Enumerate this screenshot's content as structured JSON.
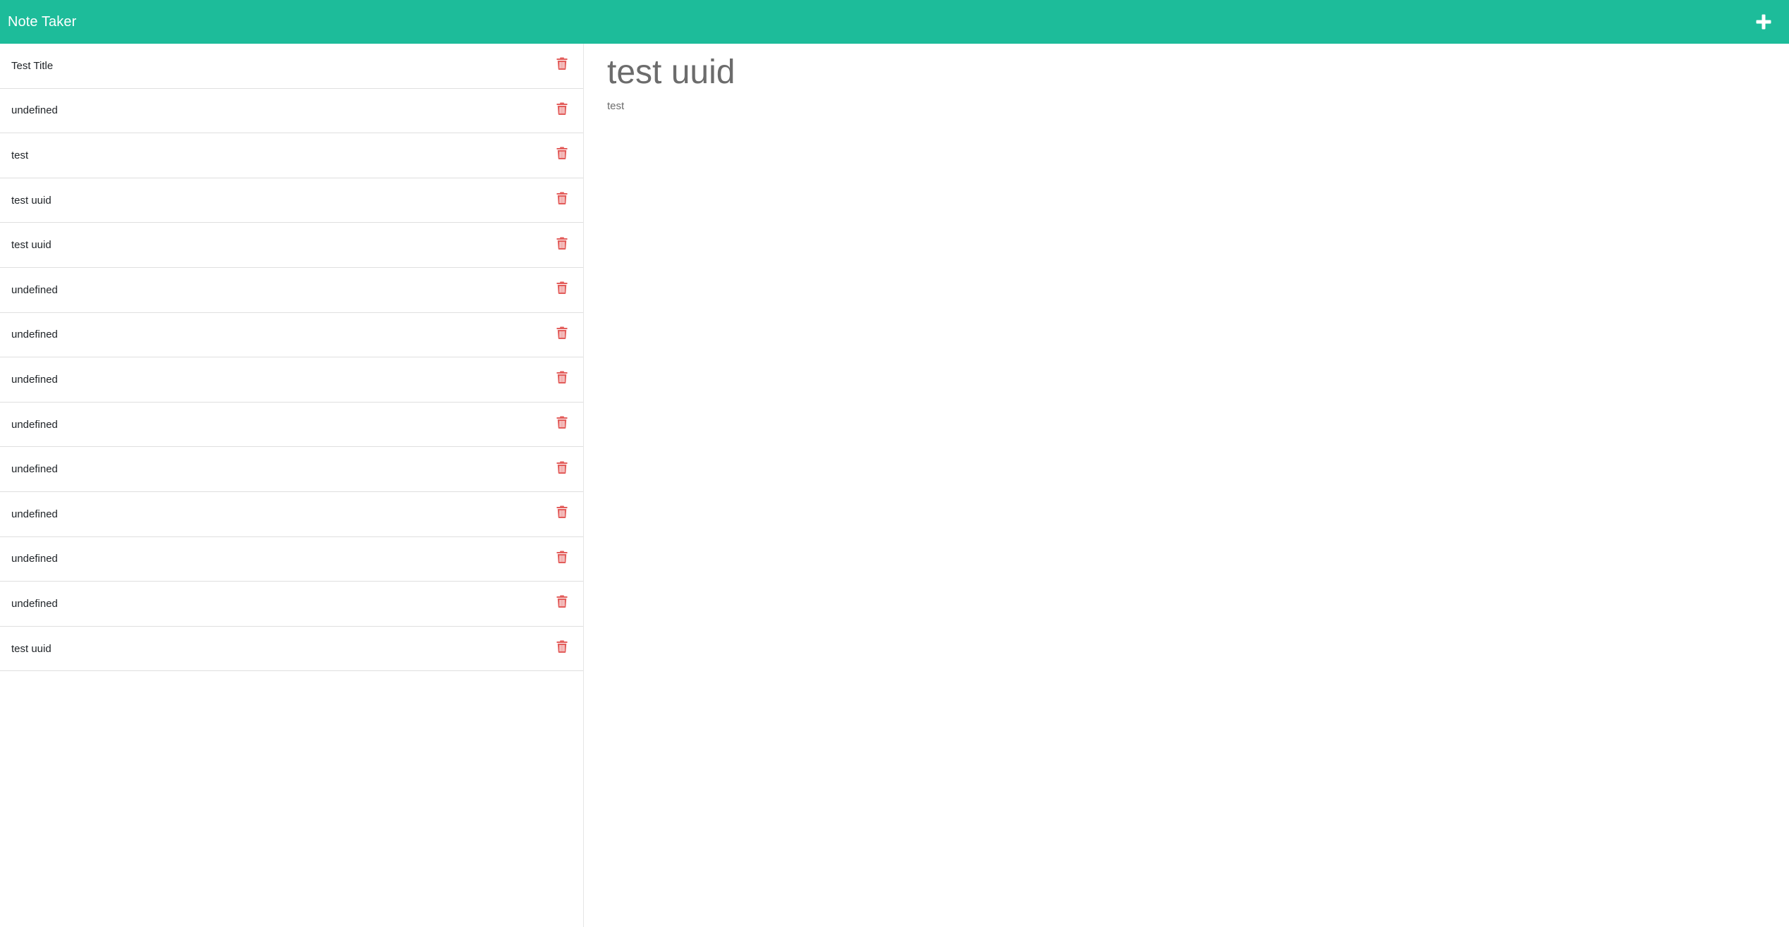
{
  "app": {
    "title": "Note Taker"
  },
  "colors": {
    "navbar": "#1dbc9a",
    "delete_icon": "#e35d5b"
  },
  "icons": {
    "new_note": "plus-icon",
    "delete": "trash-icon"
  },
  "notes": [
    {
      "title": "Test Title"
    },
    {
      "title": "undefined"
    },
    {
      "title": "test"
    },
    {
      "title": "test uuid"
    },
    {
      "title": "test uuid"
    },
    {
      "title": "undefined"
    },
    {
      "title": "undefined"
    },
    {
      "title": "undefined"
    },
    {
      "title": "undefined"
    },
    {
      "title": "undefined"
    },
    {
      "title": "undefined"
    },
    {
      "title": "undefined"
    },
    {
      "title": "undefined"
    },
    {
      "title": "test uuid"
    }
  ],
  "editor": {
    "title": "test uuid",
    "text": "test"
  }
}
